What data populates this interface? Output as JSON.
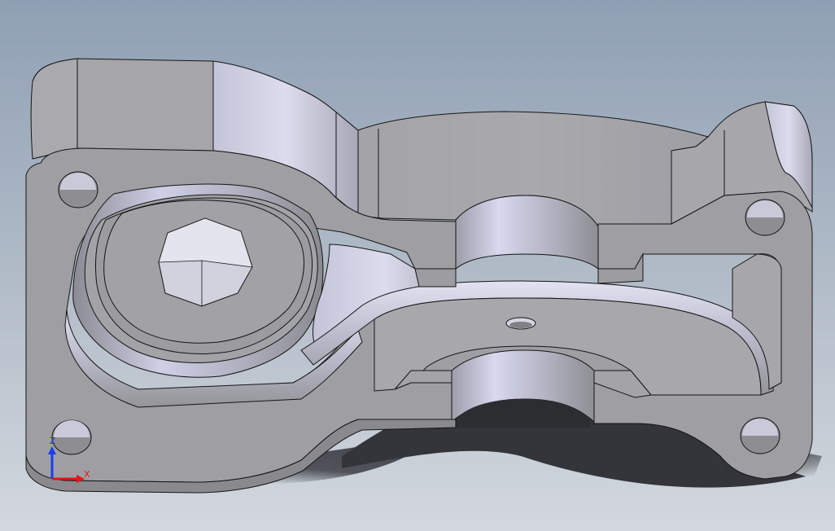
{
  "viewport": {
    "background_top": "#8fa0b4",
    "background_bottom": "#d3d8de",
    "part_colors": {
      "face_light": "#a7a7ab",
      "face_mid": "#9a9aa0",
      "face_dark": "#858589",
      "edge": "#141414",
      "highlight": "#e6e6f4",
      "shadow": "#2e2f33"
    }
  },
  "triad": {
    "z_label": "Z",
    "x_label": "X",
    "z_color": "#1a3cf0",
    "x_color": "#e51515"
  }
}
